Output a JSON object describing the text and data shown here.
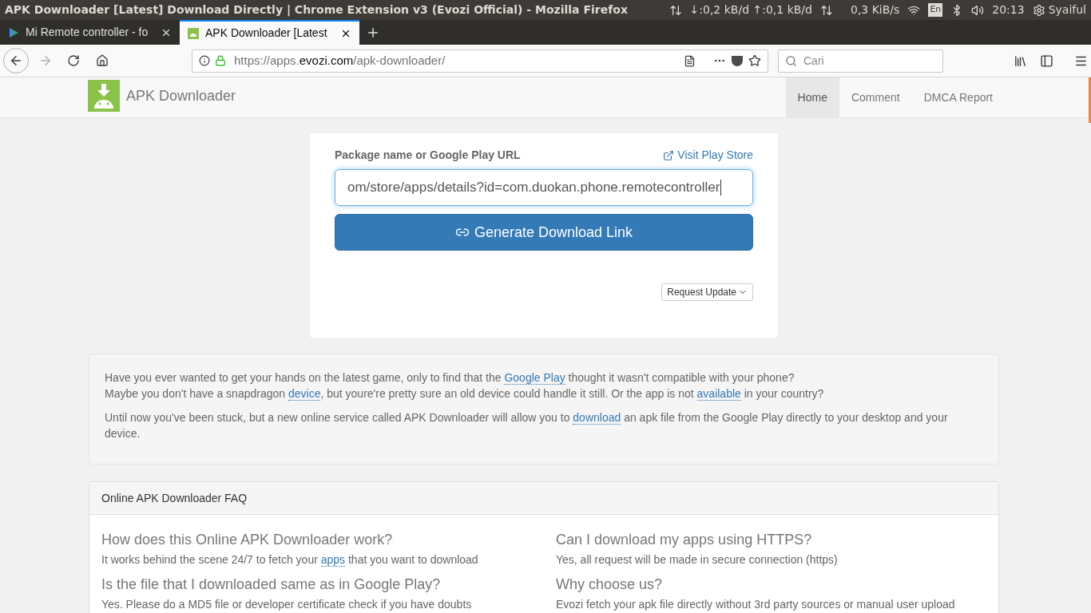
{
  "system_bar": {
    "window_title": "APK Downloader [Latest] Download Directly | Chrome Extension v3 (Evozi Official) - Mozilla Firefox",
    "net_speed": "↓:0,2 kB/d ↑:0,1 kB/d",
    "transfer_rate": "0,3 KiB/s",
    "keyboard_layout": "En",
    "clock": "20:13",
    "user": "Syaiful"
  },
  "tabs": [
    {
      "title": "Mi Remote controller - fo",
      "selected": false,
      "kind": "play"
    },
    {
      "title": "APK Downloader [Latest",
      "selected": true,
      "kind": "apk"
    }
  ],
  "address_bar": {
    "url_prefix": "https://apps.",
    "url_domain": "evozi.com",
    "url_path": "/apk-downloader/"
  },
  "search_field": {
    "placeholder": "Cari"
  },
  "site_nav": {
    "brand": "APK Downloader",
    "items": [
      {
        "label": "Home",
        "selected": true
      },
      {
        "label": "Comment",
        "selected": false
      },
      {
        "label": "DMCA Report",
        "selected": false
      }
    ]
  },
  "form": {
    "label": "Package name or Google Play URL",
    "visit_link": "Visit Play Store",
    "input_value": "om/store/apps/details?id=com.duokan.phone.remotecontroller",
    "generate_button": "Generate Download Link",
    "request_button": "Request Update"
  },
  "intro": {
    "paragraphs": [
      [
        [
          {
            "text": "Have you ever wanted to get your hands on the latest game, only to find that the ",
            "link": false
          },
          {
            "text": "Google Play",
            "link": true
          },
          {
            "text": " thought it wasn't compatible with your phone?",
            "link": false
          }
        ],
        [
          {
            "text": "Maybe you don't have a snapdragon ",
            "link": false
          },
          {
            "text": "device",
            "link": true
          },
          {
            "text": ", but youre're pretty sure an old device could handle it still. Or the app is not ",
            "link": false
          },
          {
            "text": "available",
            "link": true
          },
          {
            "text": " in your country?",
            "link": false
          }
        ]
      ],
      [
        [
          {
            "text": "Until now you've been stuck, but a new online service called APK Downloader will allow you to ",
            "link": false
          },
          {
            "text": "download",
            "link": true
          },
          {
            "text": " an apk file from the Google Play directly to your desktop and your device.",
            "link": false
          }
        ]
      ]
    ]
  },
  "faq": {
    "title": "Online APK Downloader FAQ",
    "items": [
      {
        "question": "How does this Online APK Downloader work?",
        "answer": [
          {
            "text": "It works behind the scene 24/7 to fetch your ",
            "link": false
          },
          {
            "text": "apps",
            "link": true
          },
          {
            "text": " that you want to download",
            "link": false
          }
        ]
      },
      {
        "question": "Can I download my apps using HTTPS?",
        "answer": [
          {
            "text": "Yes, all request will be made in secure connection (https)",
            "link": false
          }
        ]
      },
      {
        "question": "Is the file that I downloaded same as in Google Play?",
        "answer": [
          {
            "text": "Yes. Please do a MD5 file or developer certificate check if you have doubts",
            "link": false
          }
        ]
      },
      {
        "question": "Why choose us?",
        "answer": [
          {
            "text": "Evozi fetch your apk file directly without 3rd party sources or manual user upload",
            "link": false
          }
        ]
      }
    ]
  }
}
